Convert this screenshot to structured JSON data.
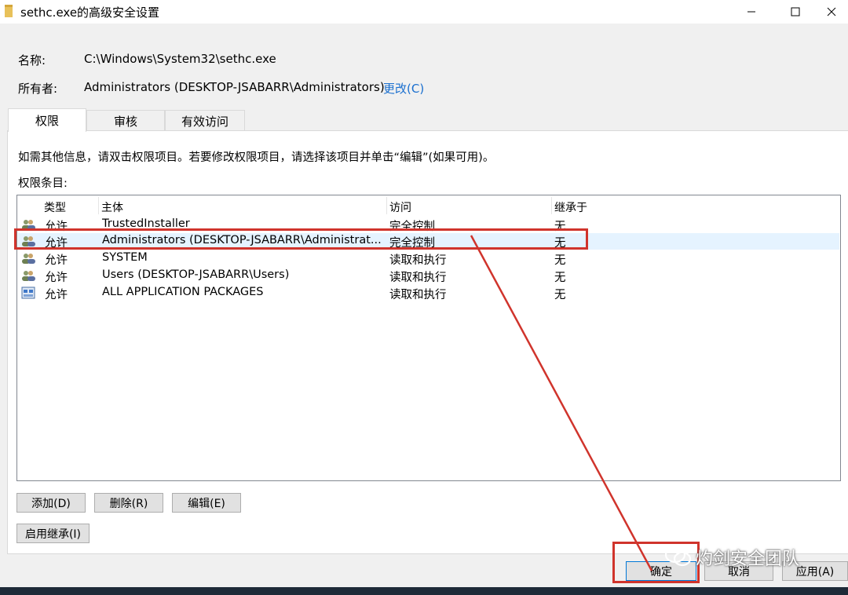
{
  "window": {
    "title": "sethc.exe的高级安全设置"
  },
  "info": {
    "name_label": "名称:",
    "name_value": "C:\\Windows\\System32\\sethc.exe",
    "owner_label": "所有者:",
    "owner_value": "Administrators (DESKTOP-JSABARR\\Administrators)",
    "change_link": "更改(C)"
  },
  "tabs": [
    {
      "label": "权限",
      "active": true
    },
    {
      "label": "审核",
      "active": false
    },
    {
      "label": "有效访问",
      "active": false
    }
  ],
  "panel": {
    "hint": "如需其他信息，请双击权限项目。若要修改权限项目，请选择该项目并单击“编辑”(如果可用)。",
    "entries_label": "权限条目:"
  },
  "list": {
    "columns": [
      "类型",
      "主体",
      "访问",
      "继承于"
    ],
    "rows": [
      {
        "icon": "users-group-icon",
        "type": "允许",
        "principal": "TrustedInstaller",
        "access": "完全控制",
        "inherited": "无"
      },
      {
        "icon": "users-group-icon",
        "type": "允许",
        "principal": "Administrators (DESKTOP-JSABARR\\Administrat...",
        "access": "完全控制",
        "inherited": "无",
        "selected": true
      },
      {
        "icon": "users-group-icon",
        "type": "允许",
        "principal": "SYSTEM",
        "access": "读取和执行",
        "inherited": "无"
      },
      {
        "icon": "users-group-icon",
        "type": "允许",
        "principal": "Users (DESKTOP-JSABARR\\Users)",
        "access": "读取和执行",
        "inherited": "无"
      },
      {
        "icon": "app-packages-icon",
        "type": "允许",
        "principal": "ALL APPLICATION PACKAGES",
        "access": "读取和执行",
        "inherited": "无"
      }
    ]
  },
  "buttons": {
    "add": "添加(D)",
    "remove": "删除(R)",
    "edit": "编辑(E)",
    "enable_inheritance": "启用继承(I)",
    "ok": "确定",
    "cancel": "取消",
    "apply": "应用(A)"
  },
  "watermark": "灼剑安全团队",
  "colors": {
    "annotation_red": "#d0342c",
    "link_blue": "#1a6fcf",
    "selection": "#e5f3ff"
  }
}
